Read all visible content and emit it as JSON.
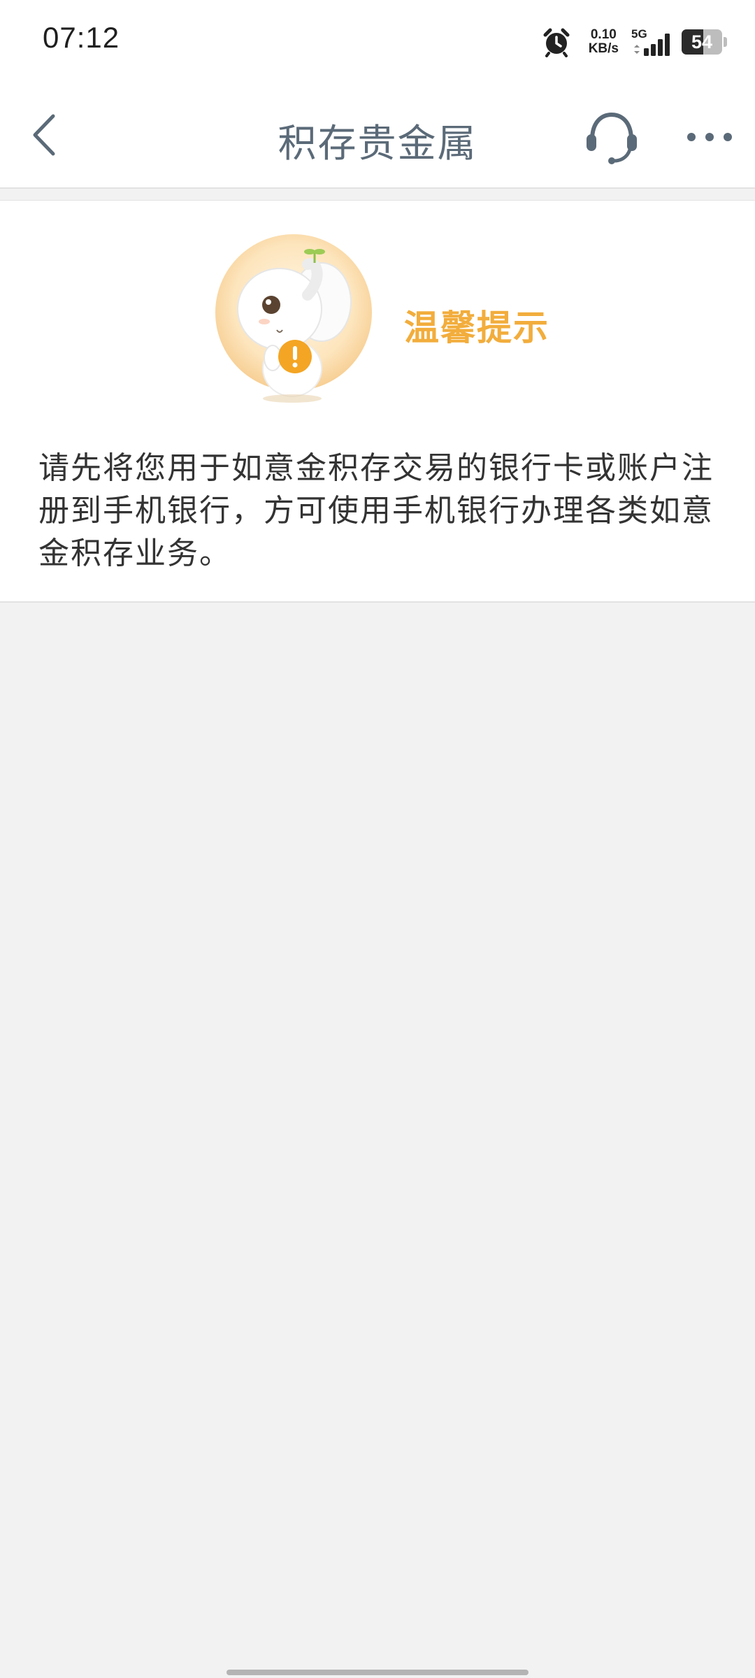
{
  "status_bar": {
    "time": "07:12",
    "net_speed_value": "0.10",
    "net_speed_unit": "KB/s",
    "network_type": "5G",
    "battery_percent": "54",
    "battery_level": 0.54,
    "icons": [
      "alarm-icon",
      "signal-icon",
      "battery-icon"
    ]
  },
  "navbar": {
    "title": "积存贵金属",
    "icons": [
      "back-arrow-icon",
      "headset-icon",
      "more-icon"
    ],
    "icon_color": "#5b6a78"
  },
  "notice": {
    "title": "温馨提示",
    "message": "请先将您用于如意金积存交易的银行卡或账户注册到手机银行，方可使用手机银行办理各类如意金积存业务。",
    "title_color": "#f2ad3c",
    "mascot": "elephant-mascot-warning-icon"
  },
  "colors": {
    "background": "#f2f2f2",
    "card": "#ffffff",
    "accent": "#f2ad3c"
  }
}
